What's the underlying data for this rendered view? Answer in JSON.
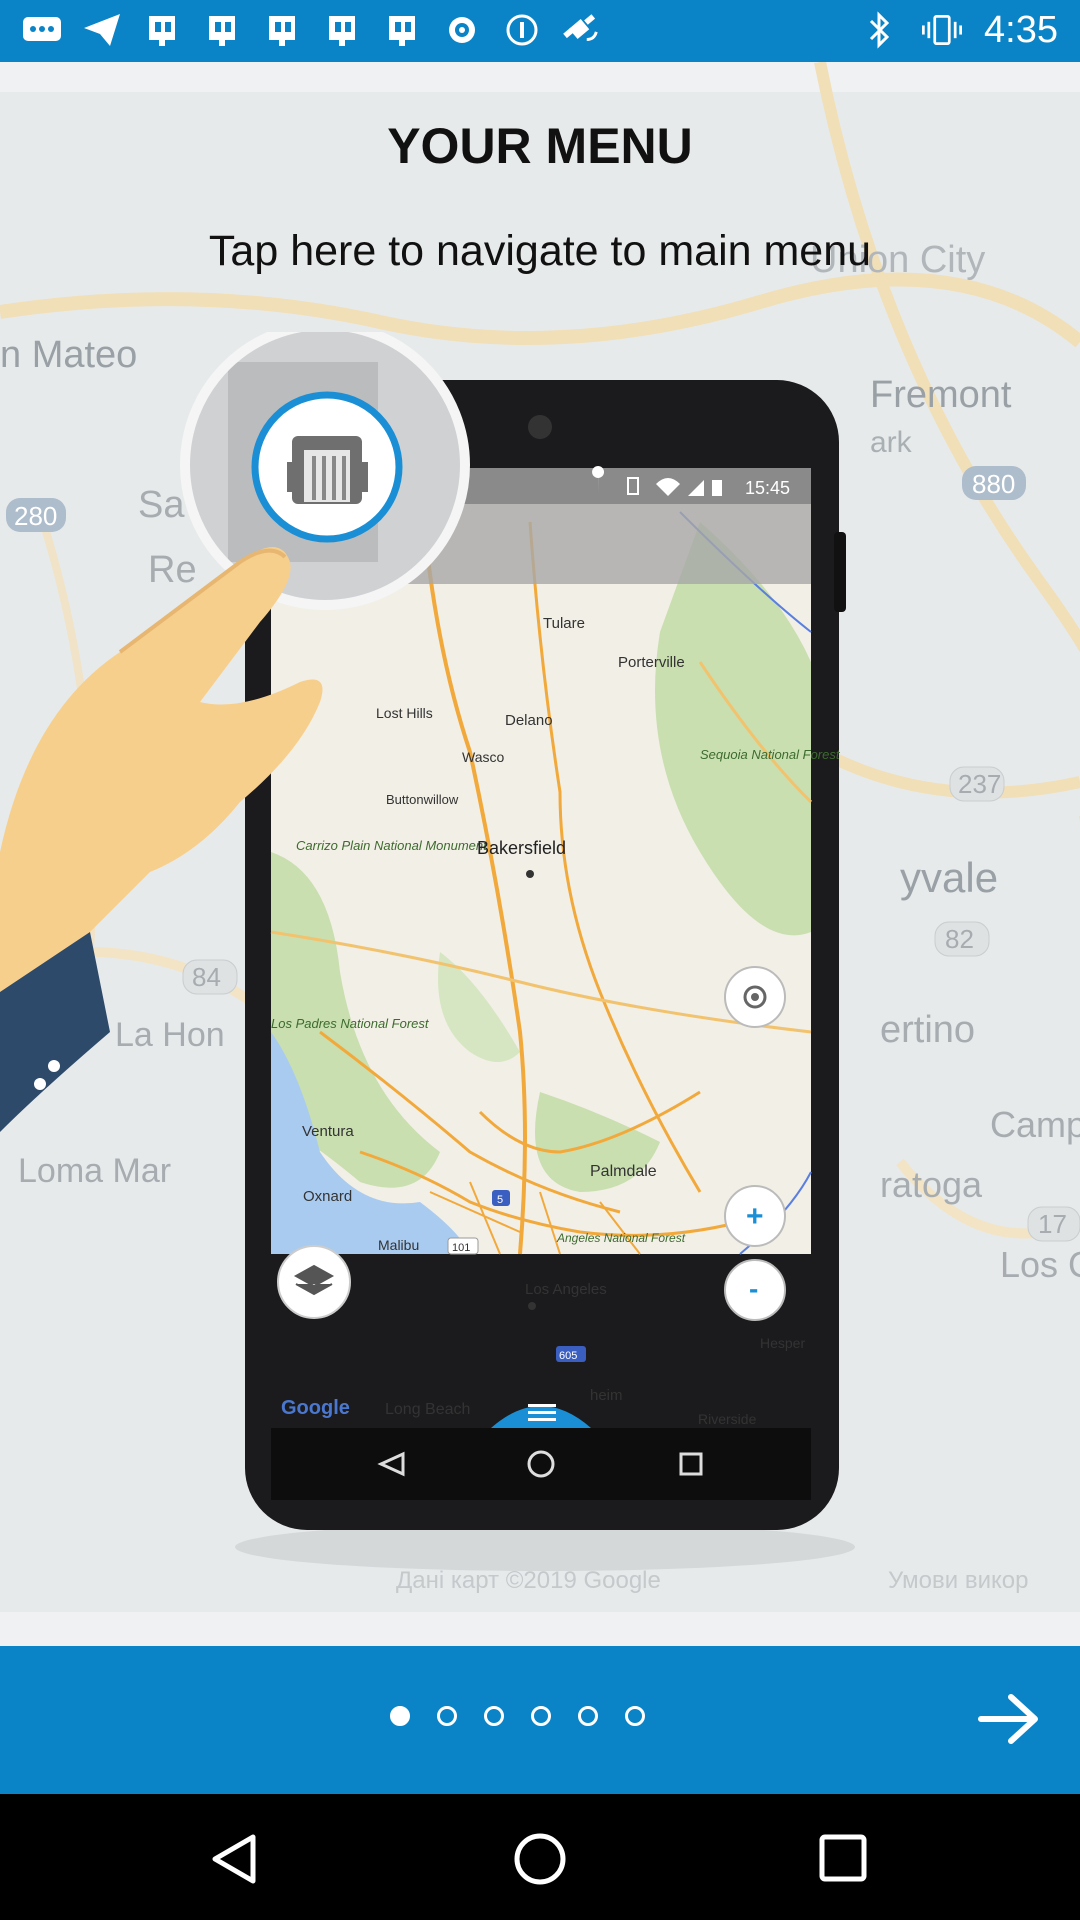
{
  "status_bar": {
    "time": "4:35",
    "left_icons": [
      "messenger-icon",
      "telegram-icon",
      "notification-icon",
      "notification-icon",
      "notification-icon",
      "notification-icon",
      "notification-icon",
      "target-icon",
      "info-icon",
      "fake-gps-icon"
    ],
    "right_icons": [
      "bluetooth-icon",
      "vibrate-icon"
    ]
  },
  "onboarding": {
    "title": "YOUR MENU",
    "subtitle": "Tap here to navigate to main menu"
  },
  "background_map_labels": [
    "n Mateo",
    "Union City",
    "Fremont",
    "ark",
    "280",
    "880",
    "Sa",
    "Re",
    "237",
    "yvale",
    "82",
    "84",
    "La Hon",
    "ertino",
    "Loma Mar",
    "Camp",
    "ratoga",
    "17",
    "Los Ga",
    "Дані карт ©2019 Google",
    "Умови викор"
  ],
  "phone_screen": {
    "status_time": "15:45",
    "map_labels": [
      "Tulare",
      "Porterville",
      "Lost Hills",
      "Delano",
      "Wasco",
      "Sequoia National Forest",
      "Buttonwillow",
      "Carrizo Plain National Monument",
      "Bakersfield",
      "Los Padres National Forest",
      "Ventura",
      "Palmdale",
      "Oxnard",
      "5",
      "Malibu",
      "101",
      "Angeles National Forest",
      "Los Angeles",
      "605",
      "Hesper",
      "Long Beach",
      "heim",
      "Riverside",
      "Google"
    ],
    "zoom_in_label": "+",
    "zoom_out_label": "-"
  },
  "pager": {
    "total_pages": 6,
    "current_page": 1
  },
  "colors": {
    "brand_blue": "#0a84c6",
    "accent_light_blue": "#1a8fd6"
  }
}
